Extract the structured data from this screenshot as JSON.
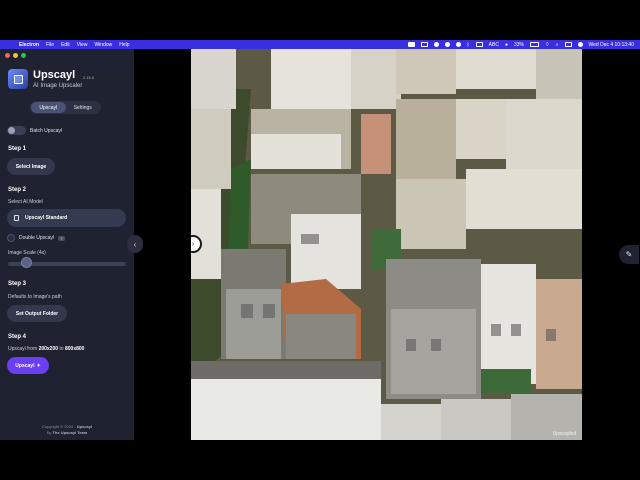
{
  "menubar": {
    "app_name": "Electron",
    "items": [
      "File",
      "Edit",
      "View",
      "Window",
      "Help"
    ],
    "abc": "ABC",
    "battery": "33%",
    "datetime": "Wed Dec 4  10:13:40"
  },
  "app": {
    "title": "Upscayl",
    "version": "2.15.0",
    "subtitle": "AI Image Upscaler"
  },
  "tabs": [
    {
      "label": "Upscayl",
      "active": true
    },
    {
      "label": "Settings",
      "active": false
    }
  ],
  "batch": {
    "label": "Batch Upscayl",
    "enabled": false
  },
  "step1": {
    "title": "Step 1",
    "button": "Select Image"
  },
  "step2": {
    "title": "Step 2",
    "model_label": "Select AI Model",
    "model_value": "Upscayl Standard",
    "double_label": "Double Upscayl",
    "double_info": "?",
    "scale_label": "Image Scale (4x)",
    "scale_value": 4
  },
  "step3": {
    "title": "Step 3",
    "desc": "Defaults to Image's path",
    "button": "Set Output Folder"
  },
  "step4": {
    "title": "Step 4",
    "from_prefix": "Upscayl from ",
    "from_size": "200x200",
    "to_word": " to ",
    "to_size": "800x800",
    "button": "Upscayl",
    "button_icon": "sparkle-icon"
  },
  "footer": {
    "line1": "Copyright © 2024 - ",
    "brand": "Upscayl",
    "line2_prefix": "By ",
    "team": "The Upscayl Team"
  },
  "preview": {
    "watermark": "Upscayled"
  },
  "colors": {
    "accent": "#6b3ff5",
    "menubar": "#3a2fe0",
    "sidebar": "#1f2230"
  }
}
